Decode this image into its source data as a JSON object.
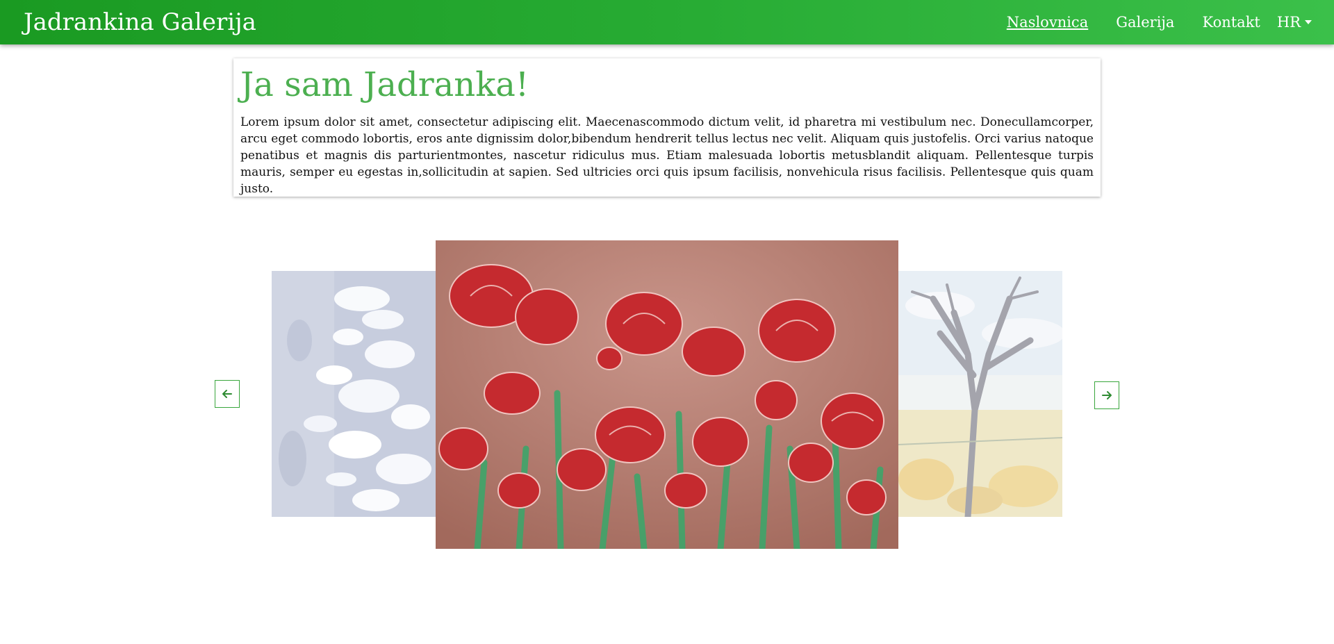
{
  "navbar": {
    "brand": "Jadrankina Galerija",
    "links": [
      {
        "label": "Naslovnica",
        "active": true
      },
      {
        "label": "Galerija",
        "active": false
      },
      {
        "label": "Kontakt",
        "active": false
      }
    ],
    "language": "HR"
  },
  "intro": {
    "title": "Ja sam Jadranka!",
    "text": "Lorem ipsum dolor sit amet, consectetur adipiscing elit. Maecenascommodo dictum velit, id pharetra mi vestibulum nec. Donecullamcorper, arcu eget commodo lobortis, eros ante dignissim dolor,bibendum hendrerit tellus lectus nec velit. Aliquam quis justofelis. Orci varius natoque penatibus et magnis dis parturientmontes, nascetur ridiculus mus. Etiam malesuada lobortis metusblandit aliquam. Pellentesque turpis mauris, semper eu egestas in,sollicitudin at sapien. Sed ultricies orci quis ipsum facilisis, nonvehicula risus facilisis. Pellentesque quis quam justo."
  },
  "carousel": {
    "slides": [
      {
        "subject": "abstract-blue-white-painting",
        "state": "previous"
      },
      {
        "subject": "red-poppies-painting",
        "state": "active"
      },
      {
        "subject": "watercolor-tree-painting",
        "state": "next"
      }
    ],
    "prev_icon": "arrow-left-icon",
    "next_icon": "arrow-right-icon"
  },
  "colors": {
    "nav_start": "#1a9a22",
    "nav_end": "#3bc04a",
    "title_green": "#4caf50",
    "arrow_border": "#38a63c"
  }
}
